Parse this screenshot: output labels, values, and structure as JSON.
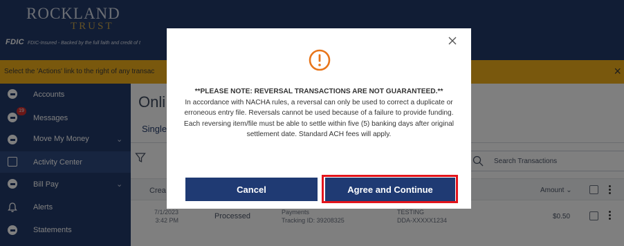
{
  "header": {
    "logo_top": "ROCKLAND",
    "logo_bottom": "TRUST",
    "fdic_mark": "FDIC",
    "fdic_text": "FDIC-Insured - Backed by the full faith and credit of t"
  },
  "banner": {
    "text": "Select the 'Actions' link to the right of any transac",
    "close_glyph": "×"
  },
  "sidebar": {
    "items": [
      {
        "label": "Accounts",
        "icon": "accounts-icon"
      },
      {
        "label": "Messages",
        "icon": "messages-icon",
        "badge": "19"
      },
      {
        "label": "Move My Money",
        "icon": "move-money-icon",
        "chevron": "⌄"
      },
      {
        "label": "Activity Center",
        "icon": "activity-center-icon",
        "active": true
      },
      {
        "label": "Bill Pay",
        "icon": "bill-pay-icon",
        "chevron": "⌄"
      },
      {
        "label": "Alerts",
        "icon": "bell-icon"
      },
      {
        "label": "Statements",
        "icon": "statements-icon"
      }
    ]
  },
  "main": {
    "title": "Onli",
    "tab": "Single",
    "search_placeholder": "Search Transactions",
    "table": {
      "col_created": "Crea",
      "col_amount": "Amount",
      "sort_glyph": "⌄"
    },
    "row": {
      "date": "7/1/2023",
      "time": "3:42 PM",
      "status": "Processed",
      "payee": "Payments",
      "tracking": "Tracking ID: 39208325",
      "account_name": "TESTING",
      "account": "DDA-XXXXX1234",
      "amount": "$0.50"
    }
  },
  "modal": {
    "note": "**PLEASE NOTE: REVERSAL TRANSACTIONS ARE NOT GUARANTEED.**",
    "body": "In accordance with NACHA rules, a reversal can only be used to correct a duplicate or erroneous entry file. Reversals cannot be used because of a failure to provide funding. Each reversing item/file must be able to settle within five (5) banking days after original settlement date. Standard ACH fees will apply.",
    "cancel_label": "Cancel",
    "agree_label": "Agree and Continue",
    "alert_color": "#e8751a",
    "button_color": "#1f3a73",
    "focus_color": "#e3141b"
  }
}
